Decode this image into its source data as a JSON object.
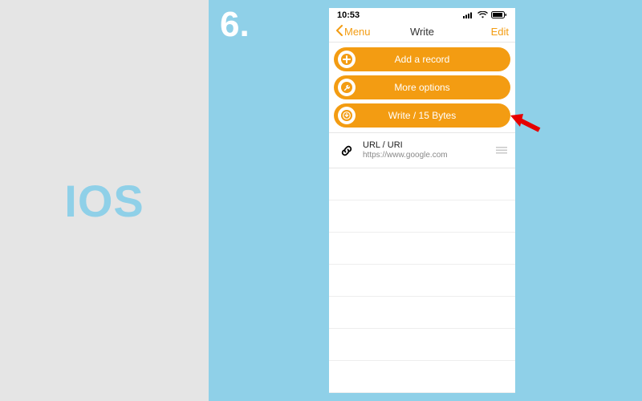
{
  "left": {
    "label": "IOS"
  },
  "step": {
    "number": "6."
  },
  "statusbar": {
    "time": "10:53"
  },
  "navbar": {
    "back_label": "Menu",
    "title": "Write",
    "edit_label": "Edit"
  },
  "buttons": {
    "add_record": "Add a record",
    "more_options": "More options",
    "write": "Write / 15 Bytes"
  },
  "record": {
    "title": "URL / URI",
    "subtitle": "https://www.google.com"
  },
  "colors": {
    "accent": "#f39c12",
    "bg_blue": "#8fd0e8"
  }
}
